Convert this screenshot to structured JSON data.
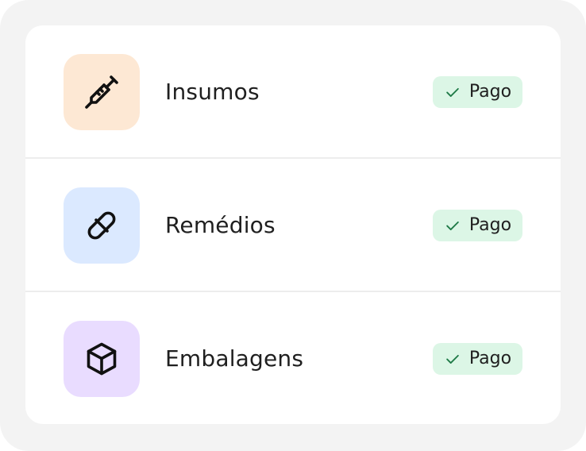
{
  "colors": {
    "outer_background": "#f3f3f3",
    "card_background": "#ffffff",
    "divider": "#ededed",
    "badge_background": "#dcf6e6",
    "badge_check": "#1f7a47",
    "text": "#1f1f1f"
  },
  "items": [
    {
      "label": "Insumos",
      "icon": "syringe-icon",
      "icon_background": "#fde8d4",
      "status": "Pago",
      "status_icon": "check-icon"
    },
    {
      "label": "Remédios",
      "icon": "pill-icon",
      "icon_background": "#dbe9ff",
      "status": "Pago",
      "status_icon": "check-icon"
    },
    {
      "label": "Embalagens",
      "icon": "box-icon",
      "icon_background": "#e9dcff",
      "status": "Pago",
      "status_icon": "check-icon"
    }
  ]
}
